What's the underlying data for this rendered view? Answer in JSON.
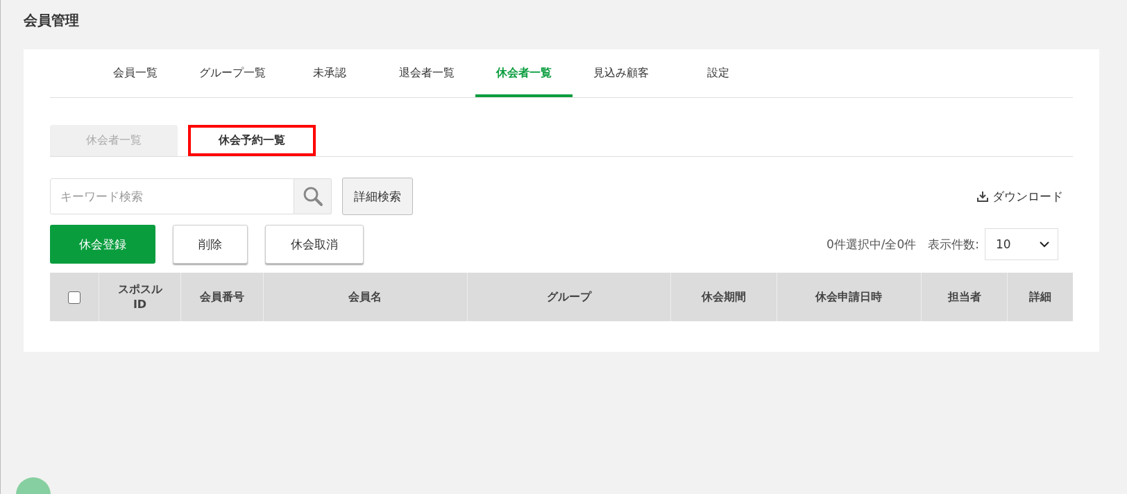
{
  "page_title": "会員管理",
  "tabs": [
    {
      "label": "会員一覧",
      "selected": false
    },
    {
      "label": "グループ一覧",
      "selected": false
    },
    {
      "label": "未承認",
      "selected": false
    },
    {
      "label": "退会者一覧",
      "selected": false
    },
    {
      "label": "休会者一覧",
      "selected": true
    },
    {
      "label": "見込み顧客",
      "selected": false
    },
    {
      "label": "設定",
      "selected": false
    }
  ],
  "sub_tabs": [
    {
      "label": "休会者一覧",
      "selected": false,
      "highlighted": false
    },
    {
      "label": "休会予約一覧",
      "selected": true,
      "highlighted": true
    }
  ],
  "search": {
    "placeholder": "キーワード検索"
  },
  "advanced_search": "詳細検索",
  "download": "ダウンロード",
  "actions": [
    {
      "label": "休会登録",
      "kind": "primary"
    },
    {
      "label": "削除",
      "kind": "secondary"
    },
    {
      "label": "休会取消",
      "kind": "secondary"
    }
  ],
  "selection_count": "0件選択中/全0件",
  "page_size": {
    "label": "表示件数:",
    "value": "10"
  },
  "table": {
    "select_all_checked": false,
    "columns": [
      {
        "label": "スポスル\nID"
      },
      {
        "label": "会員番号"
      },
      {
        "label": "会員名"
      },
      {
        "label": "グループ"
      },
      {
        "label": "休会期間"
      },
      {
        "label": "休会申請日時"
      },
      {
        "label": "担当者"
      },
      {
        "label": "詳細"
      }
    ]
  }
}
